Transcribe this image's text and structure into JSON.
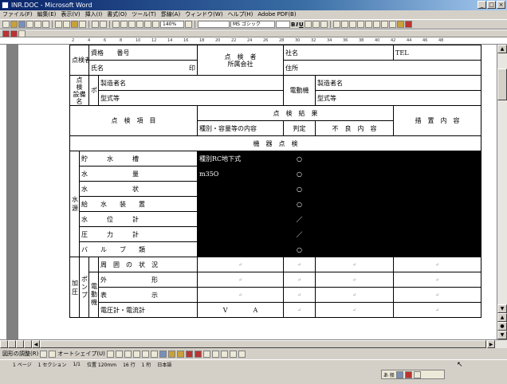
{
  "window": {
    "title": "INR.DOC - Microsoft Word",
    "min": "_",
    "max": "□",
    "close": "×"
  },
  "menu": [
    "ファイル(F)",
    "編集(E)",
    "表示(V)",
    "挿入(I)",
    "書式(O)",
    "ツール(T)",
    "罫線(A)",
    "ウィンドウ(W)",
    "ヘルプ(H)",
    "Adobe PDF(B)"
  ],
  "toolbar": {
    "zoom": "140%",
    "font": "MS ゴシック",
    "bold": "B",
    "italic": "I",
    "underline": "U"
  },
  "ruler": [
    "2",
    "4",
    "6",
    "8",
    "10",
    "12",
    "14",
    "16",
    "18",
    "20",
    "22",
    "24",
    "26",
    "28",
    "30",
    "32",
    "34",
    "36",
    "38",
    "40",
    "42",
    "44",
    "46",
    "48"
  ],
  "form": {
    "inspector_label": "点検者",
    "qualification": "資格",
    "number": "番号",
    "name": "氏名",
    "seal": "印",
    "company_label": "点　検　者\n所属会社",
    "company_name": "社名",
    "tel": "TEL",
    "address": "住所",
    "equipment_label": "点　検\n設備名",
    "pump": "ポンプ",
    "maker1": "製造者名",
    "model1": "型式等",
    "motor": "電動機",
    "maker2": "製造者名",
    "model2": "型式等",
    "items_header": "点　検　項　目",
    "results_header": "点　検　結　果",
    "measures_header": "措　置　内　容",
    "col_type": "種別・容量等の内容",
    "col_judgement": "判定",
    "col_defects": "不　良　内　容",
    "section": "機　器　点　検",
    "group_water": "水　源",
    "group_add": "加　圧",
    "sub_pump": "ポンプ",
    "sub_motor": "電動機",
    "rows": [
      {
        "item": "貯　　　水　　　槽",
        "type": "種別RC地下式",
        "judge": "○"
      },
      {
        "item": "水　　　　　　　量",
        "type": "m35O",
        "judge": "○"
      },
      {
        "item": "水　　　　　　　状",
        "type": "",
        "judge": "○"
      },
      {
        "item": "給　　水　　装　　置",
        "type": "",
        "judge": "○"
      },
      {
        "item": "水　　　位　　　計",
        "type": "",
        "judge": "／"
      },
      {
        "item": "圧　　　力　　　計",
        "type": "",
        "judge": "／"
      },
      {
        "item": "バ　　ル　　ブ　　類",
        "type": "",
        "judge": "○"
      }
    ],
    "rows_add": [
      {
        "item": "周　囲　の　状　況",
        "type": ""
      },
      {
        "item": "外　　　　　　　形",
        "type": ""
      },
      {
        "item": "表　　　　　　　示",
        "type": ""
      },
      {
        "item": "電圧計・電流計",
        "type": "V　　　　A"
      }
    ]
  },
  "status": {
    "page": "1 ページ",
    "section": "1 セクション",
    "pages": "1/1",
    "position": "位置 120mm",
    "line": "16 行",
    "col": "1 桁",
    "lang": "日本語"
  },
  "drawbar": {
    "draw": "図形の調整(R)",
    "autoshape": "オートシェイプ(U)"
  },
  "ime": {
    "label": "あ 般"
  },
  "colors": {
    "title_start": "#0a246a",
    "title_end": "#a6caf0",
    "chrome": "#d4d0c8",
    "redact": "#000000"
  }
}
